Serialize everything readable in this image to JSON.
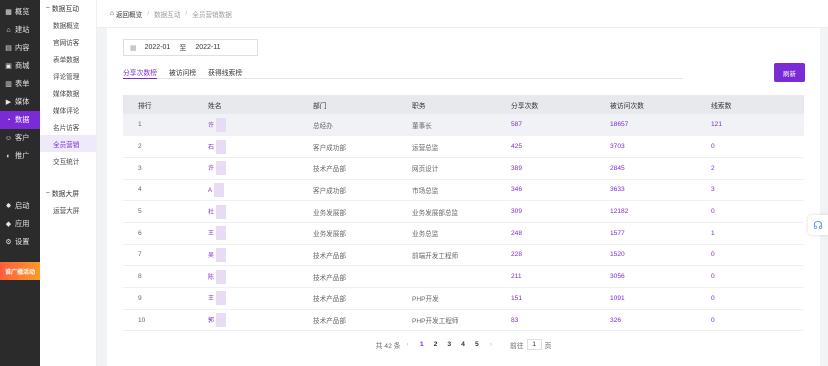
{
  "sidebar": {
    "items": [
      {
        "label": "概览",
        "icon": "grid-icon"
      },
      {
        "label": "建站",
        "icon": "home-icon"
      },
      {
        "label": "内容",
        "icon": "file-icon"
      },
      {
        "label": "商城",
        "icon": "shop-icon"
      },
      {
        "label": "表单",
        "icon": "form-icon"
      },
      {
        "label": "媒体",
        "icon": "media-icon"
      },
      {
        "label": "数据",
        "icon": "data-icon"
      },
      {
        "label": "客户",
        "icon": "user-icon"
      },
      {
        "label": "推广",
        "icon": "promote-icon"
      }
    ],
    "bottom": [
      {
        "label": "启动",
        "icon": "launch-icon"
      },
      {
        "label": "应用",
        "icon": "apps-icon"
      },
      {
        "label": "设置",
        "icon": "gear-icon"
      }
    ],
    "promo": "谁广播活动"
  },
  "subnav": {
    "group1": "数据互动",
    "items1": [
      "数据概览",
      "官网访客",
      "表单数据",
      "评论管理",
      "媒体数据",
      "媒体评论",
      "名片访客",
      "全员营销",
      "交互统计"
    ],
    "group2": "数据大屏",
    "items2": [
      "运营大屏"
    ]
  },
  "breadcrumb": {
    "back": "返回概览",
    "b1": "数据互动",
    "b2": "全员营销数据",
    "sep": "/"
  },
  "date": {
    "from": "2022-01",
    "to_label": "至",
    "to": "2022-11"
  },
  "tabs": [
    "分享次数榜",
    "被访问榜",
    "获得线索榜"
  ],
  "refresh": "刷新",
  "table": {
    "headers": [
      "排行",
      "姓名",
      "部门",
      "职务",
      "分享次数",
      "被访问次数",
      "线索数"
    ],
    "rows": [
      [
        "1",
        "许",
        "总经办",
        "董事长",
        "587",
        "18657",
        "121"
      ],
      [
        "2",
        "石",
        "客户成功部",
        "运营总监",
        "425",
        "3703",
        "0"
      ],
      [
        "3",
        "许",
        "技术产品部",
        "网页设计",
        "389",
        "2845",
        "2"
      ],
      [
        "4",
        "A",
        "客户成功部",
        "市场总监",
        "346",
        "3633",
        "3"
      ],
      [
        "5",
        "杜",
        "业务发展部",
        "业务发展部总监",
        "309",
        "12182",
        "0"
      ],
      [
        "6",
        "王",
        "业务发展部",
        "业务总监",
        "248",
        "1577",
        "1"
      ],
      [
        "7",
        "吴",
        "技术产品部",
        "前端开发工程师",
        "228",
        "1520",
        "0"
      ],
      [
        "8",
        "陈",
        "技术产品部",
        "",
        "211",
        "3056",
        "0"
      ],
      [
        "9",
        "王",
        "技术产品部",
        "PHP开发",
        "151",
        "1091",
        "0"
      ],
      [
        "10",
        "郭",
        "技术产品部",
        "PHP开发工程师",
        "83",
        "326",
        "0"
      ]
    ]
  },
  "pager": {
    "total": "共 42 条",
    "prev": "‹",
    "pages": [
      "1",
      "2",
      "3",
      "4",
      "5"
    ],
    "next": "›",
    "goto": "前往",
    "page_value": "1",
    "page_unit": "页"
  }
}
